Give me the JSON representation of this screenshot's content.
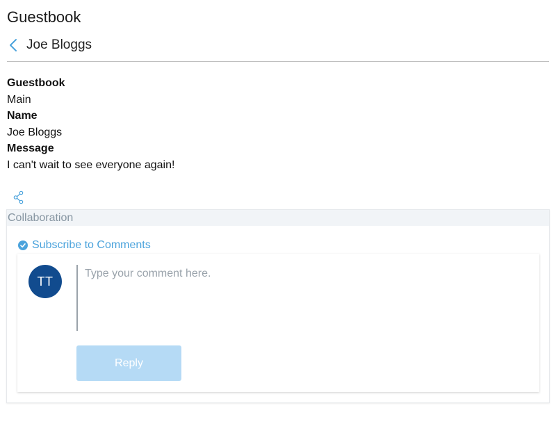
{
  "app": {
    "title": "Guestbook"
  },
  "entry": {
    "title": "Joe Bloggs",
    "back_icon": "chevron-left-icon"
  },
  "fields": [
    {
      "label": "Guestbook",
      "value": "Main"
    },
    {
      "label": "Name",
      "value": "Joe Bloggs"
    },
    {
      "label": "Message",
      "value": "I can't wait to see everyone again!"
    }
  ],
  "share": {
    "icon": "share-icon"
  },
  "collaboration": {
    "header": "Collaboration",
    "subscribe_label": "Subscribe to Comments",
    "subscribe_icon": "check-circle-icon",
    "avatar_initials": "TT",
    "comment_placeholder": "Type your comment here.",
    "comment_value": "",
    "reply_label": "Reply"
  },
  "colors": {
    "accent": "#4ba3dc",
    "avatar_bg": "#114b8e",
    "reply_disabled_bg": "#b5daf5",
    "collab_header_bg": "#f1f4f7"
  }
}
